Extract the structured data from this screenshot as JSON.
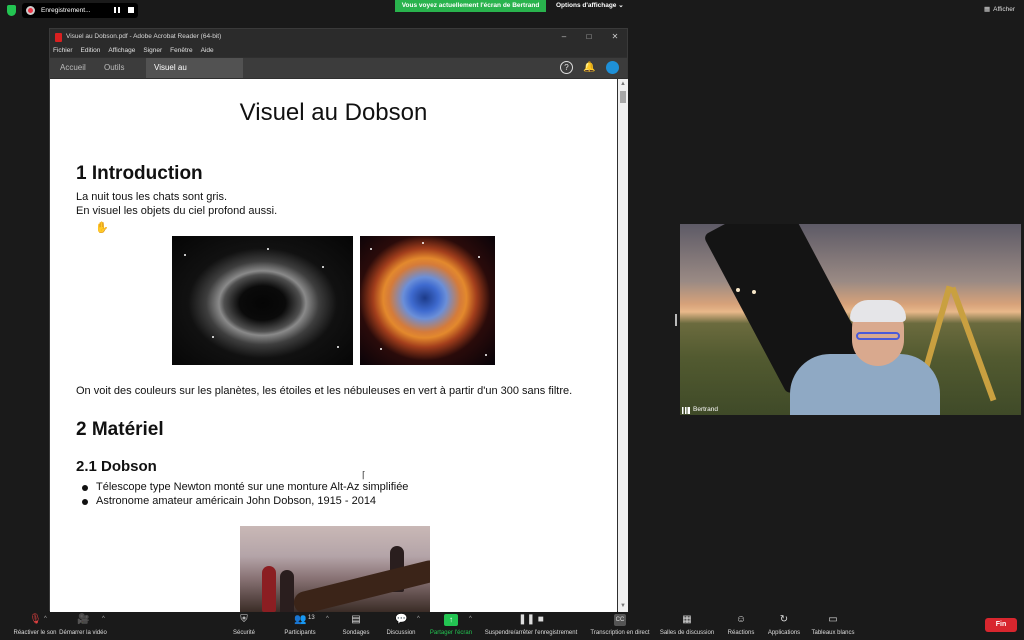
{
  "zoom": {
    "recording_label": "Enregistrement...",
    "share_banner": "Vous voyez actuellement l'écran de Bertrand",
    "view_options": "Options d'affichage",
    "view_options_caret": "⌄",
    "afficher": "Afficher",
    "participant_name": "Bertrand",
    "end_label": "Fin"
  },
  "acrobat": {
    "window_title": "Visuel au Dobson.pdf - Adobe Acrobat Reader (64-bit)",
    "menu": [
      "Fichier",
      "Edition",
      "Affichage",
      "Signer",
      "Fenêtre",
      "Aide"
    ],
    "tabs": {
      "home": "Accueil",
      "tools": "Outils",
      "document": "Visuel au Dobson.p..."
    }
  },
  "document": {
    "title": "Visuel au Dobson",
    "section1": "1 Introduction",
    "intro_line1": "La nuit tous les chats sont gris.",
    "intro_line2": "En visuel les objets du ciel profond aussi.",
    "colors_paragraph": "On voit des couleurs sur les planètes, les étoiles et les nébuleuses en vert à partir d'un 300 sans filtre.",
    "section2": "2 Matériel",
    "section2_1": "2.1 Dobson",
    "bullets": [
      "Télescope type Newton monté sur une monture Alt-Az simplifiée",
      "Astronome amateur américain John Dobson, 1915 - 2014"
    ]
  },
  "toolbar": {
    "items": [
      {
        "label": "Réactiver le son",
        "icon": "microphone-muted-icon"
      },
      {
        "label": "Démarrer la vidéo",
        "icon": "video-off-icon"
      },
      {
        "label": "Sécurité",
        "icon": "shield-icon"
      },
      {
        "label": "Participants",
        "icon": "participants-icon",
        "count": "13"
      },
      {
        "label": "Sondages",
        "icon": "polls-icon"
      },
      {
        "label": "Discussion",
        "icon": "chat-icon"
      },
      {
        "label": "Partager l'écran",
        "icon": "share-screen-icon"
      },
      {
        "label": "Suspendre/arrêter l'enregistrement",
        "icon": "recording-controls-icon"
      },
      {
        "label": "Transcription en direct",
        "icon": "cc-icon"
      },
      {
        "label": "Salles de discussion",
        "icon": "breakout-rooms-icon"
      },
      {
        "label": "Réactions",
        "icon": "reactions-icon"
      },
      {
        "label": "Applications",
        "icon": "apps-icon"
      },
      {
        "label": "Tableaux blancs",
        "icon": "whiteboard-icon"
      }
    ]
  },
  "colors": {
    "zoom_green": "#23c552",
    "end_red": "#d8262e",
    "acrobat_red": "#d92020"
  }
}
